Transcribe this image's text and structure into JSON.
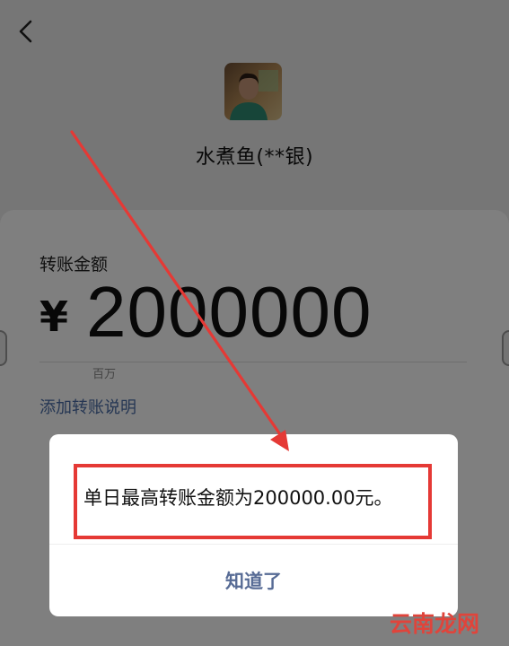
{
  "header": {
    "back_icon": "back-chevron-icon"
  },
  "payee": {
    "name": "水煮鱼(**银)"
  },
  "transfer": {
    "amount_label": "转账金额",
    "currency_symbol": "¥",
    "amount": "2000000",
    "unit_hint": "百万",
    "add_note_link": "添加转账说明"
  },
  "dialog": {
    "message": "单日最高转账金额为200000.00元。",
    "confirm_label": "知道了"
  },
  "annotation": {
    "color": "#e53935"
  },
  "watermark": {
    "text": "云南龙网"
  },
  "colors": {
    "link": "#4a6da7",
    "dialog_button": "#576b95",
    "overlay": "rgba(0,0,0,0.50)"
  }
}
